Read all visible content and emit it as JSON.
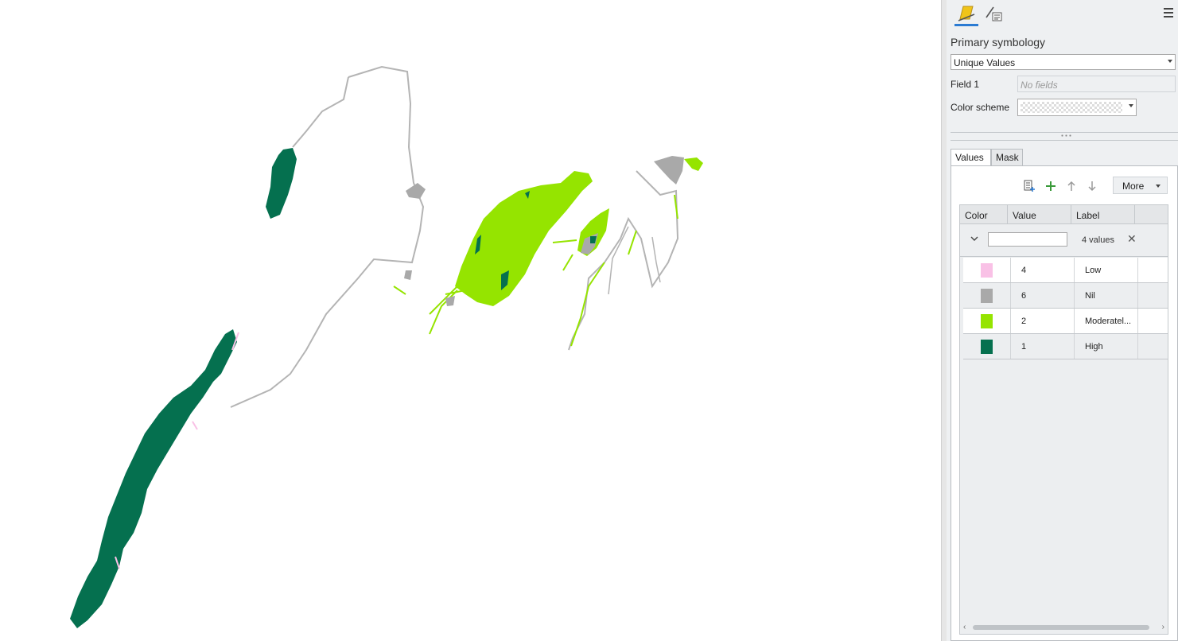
{
  "map": {
    "colors": {
      "high": "#05704f",
      "moderate": "#95e400",
      "nil": "#a9a9a9",
      "low": "#f9c1e6",
      "boundary": "#b4b4b4"
    }
  },
  "pane": {
    "tabs": [
      {
        "icon": "primary-symbology-icon"
      },
      {
        "icon": "vary-symbology-icon"
      }
    ],
    "menu_icon": "hamburger-menu-icon",
    "title": "Primary symbology",
    "renderer": "Unique Values",
    "field1_label": "Field 1",
    "field1_placeholder": "No fields",
    "color_scheme_label": "Color scheme",
    "sub_tabs": [
      "Values",
      "Mask"
    ],
    "toolbar": {
      "icons": [
        "add-all-values-icon",
        "add-value-icon",
        "move-up-icon",
        "move-down-icon"
      ],
      "more_label": "More"
    },
    "table": {
      "headers": [
        "Color",
        "Value",
        "Label"
      ],
      "group_count": "4 values",
      "rows": [
        {
          "color": "#f9c1e6",
          "value": "4",
          "label": "Low"
        },
        {
          "color": "#a9a9a9",
          "value": "6",
          "label": "Nil"
        },
        {
          "color": "#95e400",
          "value": "2",
          "label": "Moderatel..."
        },
        {
          "color": "#05704f",
          "value": "1",
          "label": "High"
        }
      ]
    }
  }
}
